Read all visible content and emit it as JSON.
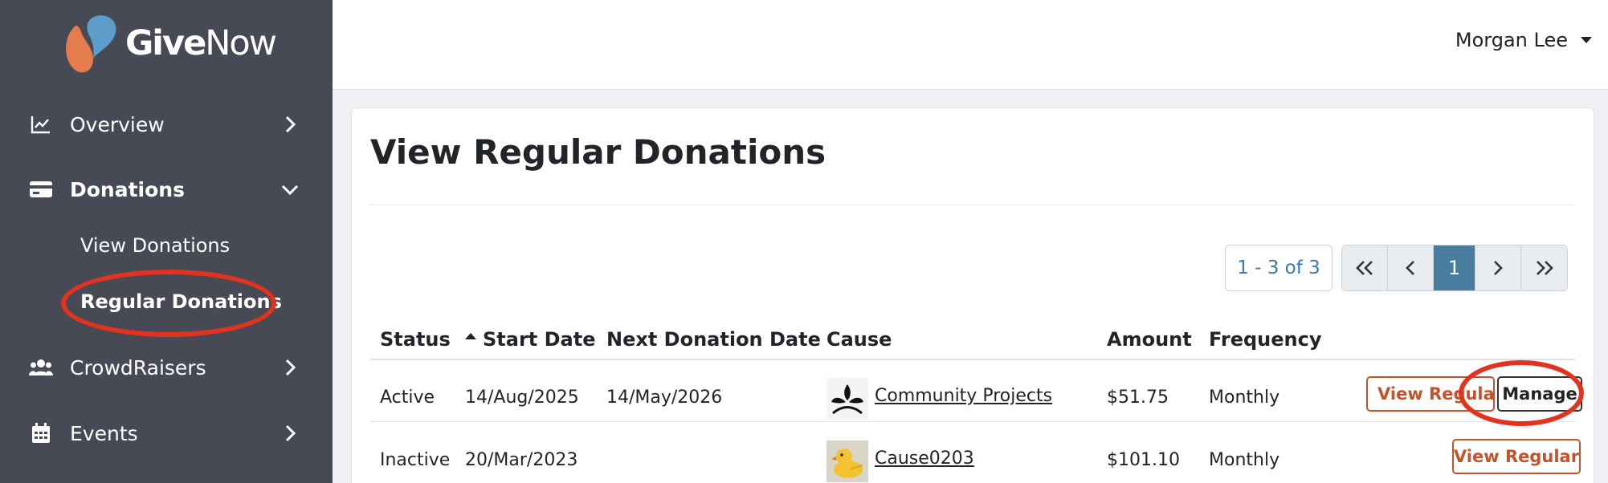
{
  "brand": {
    "name_bold": "Give",
    "name_light": "Now",
    "colors": {
      "orange": "#e57c4e",
      "blue": "#5c9ec9"
    }
  },
  "sidebar": {
    "items": [
      {
        "label": "Overview",
        "icon": "chart-line-icon",
        "chevron": "chevron-right-icon"
      },
      {
        "label": "Donations",
        "icon": "credit-card-icon",
        "chevron": "chevron-down-icon",
        "expanded": true
      },
      {
        "label": "CrowdRaisers",
        "icon": "users-icon",
        "chevron": "chevron-right-icon"
      },
      {
        "label": "Events",
        "icon": "calendar-icon",
        "chevron": "chevron-right-icon"
      }
    ],
    "subitems": [
      {
        "label": "View Donations"
      },
      {
        "label": "Regular Donations",
        "active": true
      }
    ]
  },
  "header": {
    "user_name": "Morgan Lee"
  },
  "main": {
    "title": "View Regular Donations",
    "pagination": {
      "range": "1 - 3 of 3",
      "current_page": "1"
    },
    "table": {
      "columns": [
        "Status",
        "Start Date",
        "Next Donation Date",
        "Cause",
        "Amount",
        "Frequency"
      ],
      "sorted_column": "Start Date",
      "rows": [
        {
          "status": "Active",
          "start_date": "14/Aug/2025",
          "next_date": "14/May/2026",
          "cause": "Community Projects",
          "cause_icon": "plant-logo-icon",
          "amount": "$51.75",
          "frequency": "Monthly",
          "view_label": "View Regula",
          "manage_label": "Manage"
        },
        {
          "status": "Inactive",
          "start_date": "20/Mar/2023",
          "next_date": "",
          "cause": "Cause0203",
          "cause_icon": "rubber-duck-icon",
          "amount": "$101.10",
          "frequency": "Monthly",
          "view_label": "View Regular"
        }
      ]
    }
  },
  "annotations": {
    "highlight_color": "#e3321e"
  }
}
